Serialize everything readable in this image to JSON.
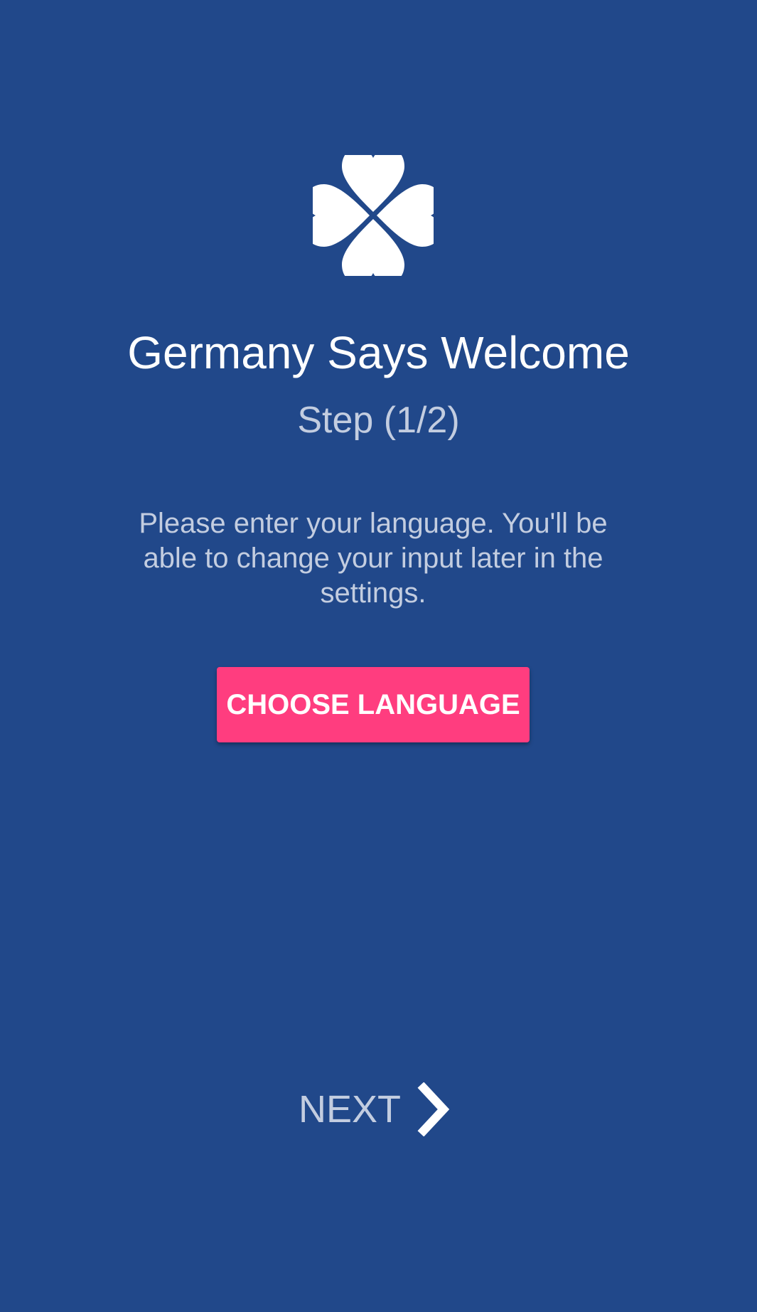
{
  "theme": {
    "background": "#21488a",
    "accent": "#ff3d7f",
    "title_color": "#ffffff",
    "muted_text": "#c3cde0"
  },
  "logo": {
    "icon": "clover-heart-logo-icon"
  },
  "onboarding": {
    "title": "Germany Says Welcome",
    "step": "Step (1/2)",
    "description": "Please enter your language. You'll be able to change your input later in the settings.",
    "choose_language_label": "CHOOSE LANGUAGE"
  },
  "footer": {
    "next_label": "NEXT",
    "next_icon": "chevron-right-icon"
  }
}
